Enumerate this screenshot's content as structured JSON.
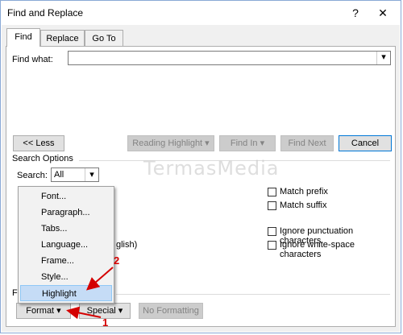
{
  "window": {
    "title": "Find and Replace",
    "help": "?",
    "close": "✕"
  },
  "tabs": [
    {
      "label": "Find",
      "active": true
    },
    {
      "label": "Replace"
    },
    {
      "label": "Go To"
    }
  ],
  "find": {
    "label": "Find what:",
    "value": ""
  },
  "buttons": {
    "less": "<< Less",
    "reading_highlight": "Reading Highlight ▾",
    "find_in": "Find In ▾",
    "find_next": "Find Next",
    "cancel": "Cancel"
  },
  "search_options": {
    "heading": "Search Options",
    "search_label": "Search:",
    "search_value": "All"
  },
  "options_right": [
    "Match prefix",
    "Match suffix",
    "Ignore punctuation characters",
    "Ignore white-space characters"
  ],
  "hidden_text": "glish)",
  "find_section_label": "Fi",
  "bottom_buttons": {
    "format": "Format ▾",
    "special": "Special ▾",
    "no_formatting": "No Formatting"
  },
  "format_menu": [
    "Font...",
    "Paragraph...",
    "Tabs...",
    "Language...",
    "Frame...",
    "Style...",
    "Highlight"
  ],
  "annotations": {
    "arrow1": "1",
    "arrow2": "2",
    "accent_color": "#d40000"
  },
  "watermark": "TermasMedia"
}
